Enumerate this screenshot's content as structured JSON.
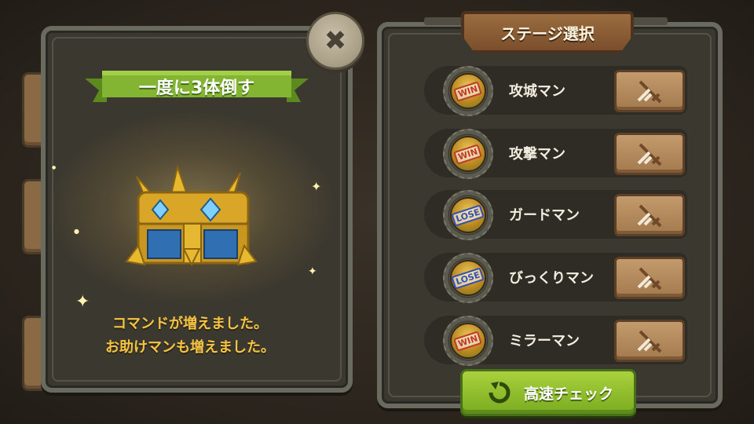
{
  "objective_banner": "一度に3体倒す",
  "reward_message": {
    "line1": "コマンドが増えました。",
    "line2": "お助けマンも増えました。"
  },
  "stage_panel": {
    "title": "ステージ選択",
    "stages": [
      {
        "name": "攻城マン",
        "result": "WIN"
      },
      {
        "name": "攻撃マン",
        "result": "WIN"
      },
      {
        "name": "ガードマン",
        "result": "LOSE"
      },
      {
        "name": "びっくりマン",
        "result": "LOSE"
      },
      {
        "name": "ミラーマン",
        "result": "WIN"
      }
    ],
    "fast_check_label": "高速チェック"
  },
  "icons": {
    "close": "close-icon",
    "chest": "treasure-chest-icon",
    "battle": "crossed-swords-icon",
    "replay": "replay-arrow-icon"
  },
  "colors": {
    "ribbon": "#7fb030",
    "message_text": "#f6c443",
    "win_stamp": "#c0392b",
    "lose_stamp": "#2e4fb8",
    "button_green": "#8fbe2c",
    "button_wood": "#b58b5c"
  }
}
